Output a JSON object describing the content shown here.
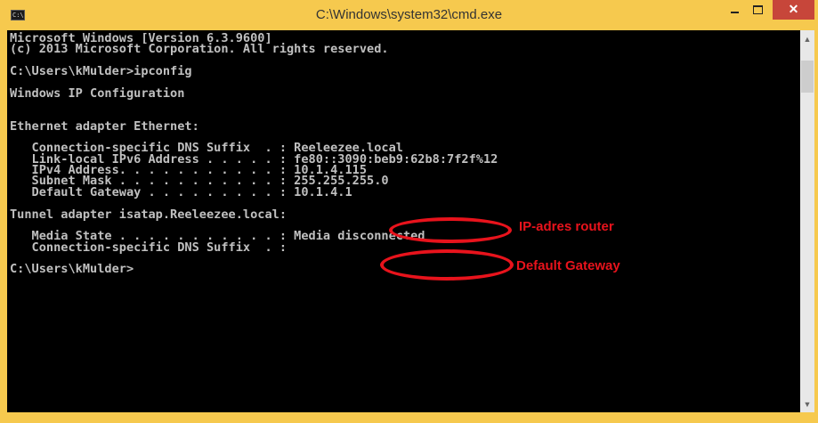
{
  "window": {
    "title": "C:\\Windows\\system32\\cmd.exe",
    "icon": "cmd-app-icon",
    "icon_text": "C:\\",
    "close_glyph": "✕",
    "scroll_up_glyph": "▲",
    "scroll_down_glyph": "▼"
  },
  "console": {
    "background": "#000000",
    "text_color": "#c0c0c0",
    "lines": [
      "Microsoft Windows [Version 6.3.9600]",
      "(c) 2013 Microsoft Corporation. All rights reserved.",
      "",
      "C:\\Users\\kMulder>ipconfig",
      "",
      "Windows IP Configuration",
      "",
      "",
      "Ethernet adapter Ethernet:",
      "",
      "   Connection-specific DNS Suffix  . : Reeleezee.local",
      "   Link-local IPv6 Address . . . . . : fe80::3090:beb9:62b8:7f2f%12",
      "   IPv4 Address. . . . . . . . . . . : 10.1.4.115",
      "   Subnet Mask . . . . . . . . . . . : 255.255.255.0",
      "   Default Gateway . . . . . . . . . : 10.1.4.1",
      "",
      "Tunnel adapter isatap.Reeleezee.local:",
      "",
      "   Media State . . . . . . . . . . . : Media disconnected",
      "   Connection-specific DNS Suffix  . :",
      "",
      "C:\\Users\\kMulder>"
    ]
  },
  "annotations": {
    "color": "#e8131c",
    "ipv4_label": "IP-adres router",
    "gateway_label": "Default Gateway"
  }
}
